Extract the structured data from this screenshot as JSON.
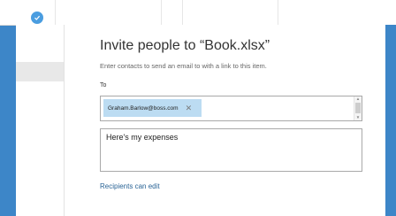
{
  "background": {
    "status_icon": "check-icon"
  },
  "dialog": {
    "title": "Invite people to “Book.xlsx”",
    "subtitle": "Enter contacts to send an email to with a link to this item.",
    "to_label": "To",
    "recipients": [
      {
        "email": "Graham.Barlow@boss.com",
        "remove_icon": "close-icon"
      }
    ],
    "message": "Here's my expenses",
    "permission_link": "Recipients can edit"
  },
  "colors": {
    "desktop_blue": "#3d86c8",
    "chip_bg": "#bcdcf2",
    "link": "#2a6496"
  }
}
